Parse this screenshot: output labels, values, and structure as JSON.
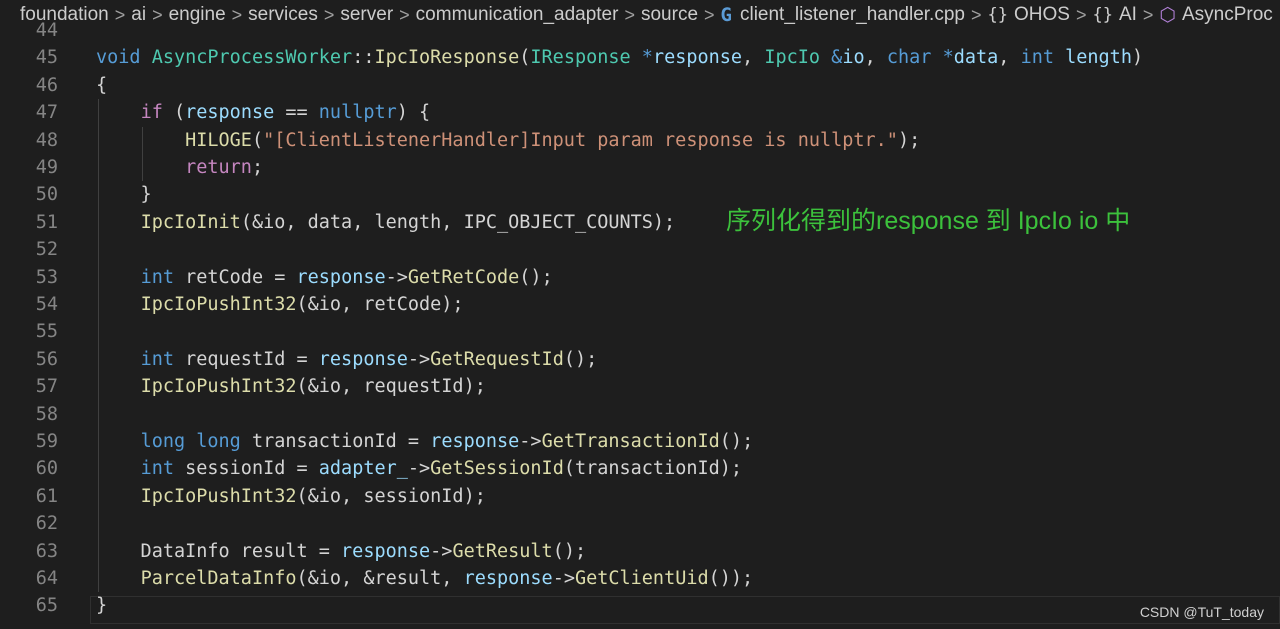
{
  "breadcrumb": {
    "items": [
      "foundation",
      "ai",
      "engine",
      "services",
      "server",
      "communication_adapter",
      "source",
      "client_listener_handler.cpp",
      "OHOS",
      "AI",
      "AsyncProc"
    ],
    "icons": {
      "file": "cpp-file-icon",
      "namespace": "namespace-braces-icon",
      "class": "class-cube-icon"
    }
  },
  "editor": {
    "line_numbers": [
      "44",
      "45",
      "46",
      "47",
      "48",
      "49",
      "50",
      "51",
      "52",
      "53",
      "54",
      "55",
      "56",
      "57",
      "58",
      "59",
      "60",
      "61",
      "62",
      "63",
      "64",
      "65"
    ],
    "lines": [
      [
        [
          "def",
          ""
        ]
      ],
      [
        [
          "kw",
          "void"
        ],
        [
          "def",
          " "
        ],
        [
          "ty",
          "AsyncProcessWorker"
        ],
        [
          "def",
          "::"
        ],
        [
          "fn",
          "IpcIoResponse"
        ],
        [
          "def",
          "("
        ],
        [
          "ty",
          "IResponse"
        ],
        [
          "def",
          " "
        ],
        [
          "kw",
          "*"
        ],
        [
          "var",
          "response"
        ],
        [
          "def",
          ", "
        ],
        [
          "ty",
          "IpcIo"
        ],
        [
          "def",
          " "
        ],
        [
          "kw",
          "&"
        ],
        [
          "var",
          "io"
        ],
        [
          "def",
          ", "
        ],
        [
          "kw",
          "char"
        ],
        [
          "def",
          " "
        ],
        [
          "kw",
          "*"
        ],
        [
          "var",
          "data"
        ],
        [
          "def",
          ", "
        ],
        [
          "kw",
          "int"
        ],
        [
          "def",
          " "
        ],
        [
          "var",
          "length"
        ],
        [
          "def",
          ")"
        ]
      ],
      [
        [
          "def",
          "{"
        ]
      ],
      [
        [
          "def",
          "    "
        ],
        [
          "ctl",
          "if"
        ],
        [
          "def",
          " ("
        ],
        [
          "var",
          "response"
        ],
        [
          "def",
          " == "
        ],
        [
          "kw",
          "nullptr"
        ],
        [
          "def",
          ") {"
        ]
      ],
      [
        [
          "def",
          "        "
        ],
        [
          "fn",
          "HILOGE"
        ],
        [
          "def",
          "("
        ],
        [
          "str",
          "\"[ClientListenerHandler]Input param response is nullptr.\""
        ],
        [
          "def",
          ");"
        ]
      ],
      [
        [
          "def",
          "        "
        ],
        [
          "ctl",
          "return"
        ],
        [
          "def",
          ";"
        ]
      ],
      [
        [
          "def",
          "    }"
        ]
      ],
      [
        [
          "def",
          "    "
        ],
        [
          "fn",
          "IpcIoInit"
        ],
        [
          "def",
          "(&io, data, length, IPC_OBJECT_COUNTS);"
        ]
      ],
      [
        [
          "def",
          ""
        ]
      ],
      [
        [
          "def",
          "    "
        ],
        [
          "kw",
          "int"
        ],
        [
          "def",
          " retCode = "
        ],
        [
          "var",
          "response"
        ],
        [
          "def",
          "->"
        ],
        [
          "fn",
          "GetRetCode"
        ],
        [
          "def",
          "();"
        ]
      ],
      [
        [
          "def",
          "    "
        ],
        [
          "fn",
          "IpcIoPushInt32"
        ],
        [
          "def",
          "(&io, retCode);"
        ]
      ],
      [
        [
          "def",
          ""
        ]
      ],
      [
        [
          "def",
          "    "
        ],
        [
          "kw",
          "int"
        ],
        [
          "def",
          " requestId = "
        ],
        [
          "var",
          "response"
        ],
        [
          "def",
          "->"
        ],
        [
          "fn",
          "GetRequestId"
        ],
        [
          "def",
          "();"
        ]
      ],
      [
        [
          "def",
          "    "
        ],
        [
          "fn",
          "IpcIoPushInt32"
        ],
        [
          "def",
          "(&io, requestId);"
        ]
      ],
      [
        [
          "def",
          ""
        ]
      ],
      [
        [
          "def",
          "    "
        ],
        [
          "kw",
          "long"
        ],
        [
          "def",
          " "
        ],
        [
          "kw",
          "long"
        ],
        [
          "def",
          " transactionId = "
        ],
        [
          "var",
          "response"
        ],
        [
          "def",
          "->"
        ],
        [
          "fn",
          "GetTransactionId"
        ],
        [
          "def",
          "();"
        ]
      ],
      [
        [
          "def",
          "    "
        ],
        [
          "kw",
          "int"
        ],
        [
          "def",
          " sessionId = "
        ],
        [
          "var",
          "adapter_"
        ],
        [
          "def",
          "->"
        ],
        [
          "fn",
          "GetSessionId"
        ],
        [
          "def",
          "(transactionId);"
        ]
      ],
      [
        [
          "def",
          "    "
        ],
        [
          "fn",
          "IpcIoPushInt32"
        ],
        [
          "def",
          "(&io, sessionId);"
        ]
      ],
      [
        [
          "def",
          ""
        ]
      ],
      [
        [
          "def",
          "    DataInfo result = "
        ],
        [
          "var",
          "response"
        ],
        [
          "def",
          "->"
        ],
        [
          "fn",
          "GetResult"
        ],
        [
          "def",
          "();"
        ]
      ],
      [
        [
          "def",
          "    "
        ],
        [
          "fn",
          "ParcelDataInfo"
        ],
        [
          "def",
          "(&io, &result, "
        ],
        [
          "var",
          "response"
        ],
        [
          "def",
          "->"
        ],
        [
          "fn",
          "GetClientUid"
        ],
        [
          "def",
          "());"
        ]
      ],
      [
        [
          "def",
          "}"
        ]
      ]
    ]
  },
  "annotation": {
    "text": "序列化得到的response 到 IpcIo io 中",
    "color": "#3cc13c"
  },
  "watermark": "CSDN @TuT_today",
  "colors": {
    "background": "#1e1e1e",
    "keyword": "#569cd6",
    "control": "#c586c0",
    "function": "#dcdcaa",
    "type": "#4ec9b0",
    "variable": "#9cdcfe",
    "string": "#ce9178",
    "default": "#d4d4d4",
    "line_number": "#858585"
  }
}
